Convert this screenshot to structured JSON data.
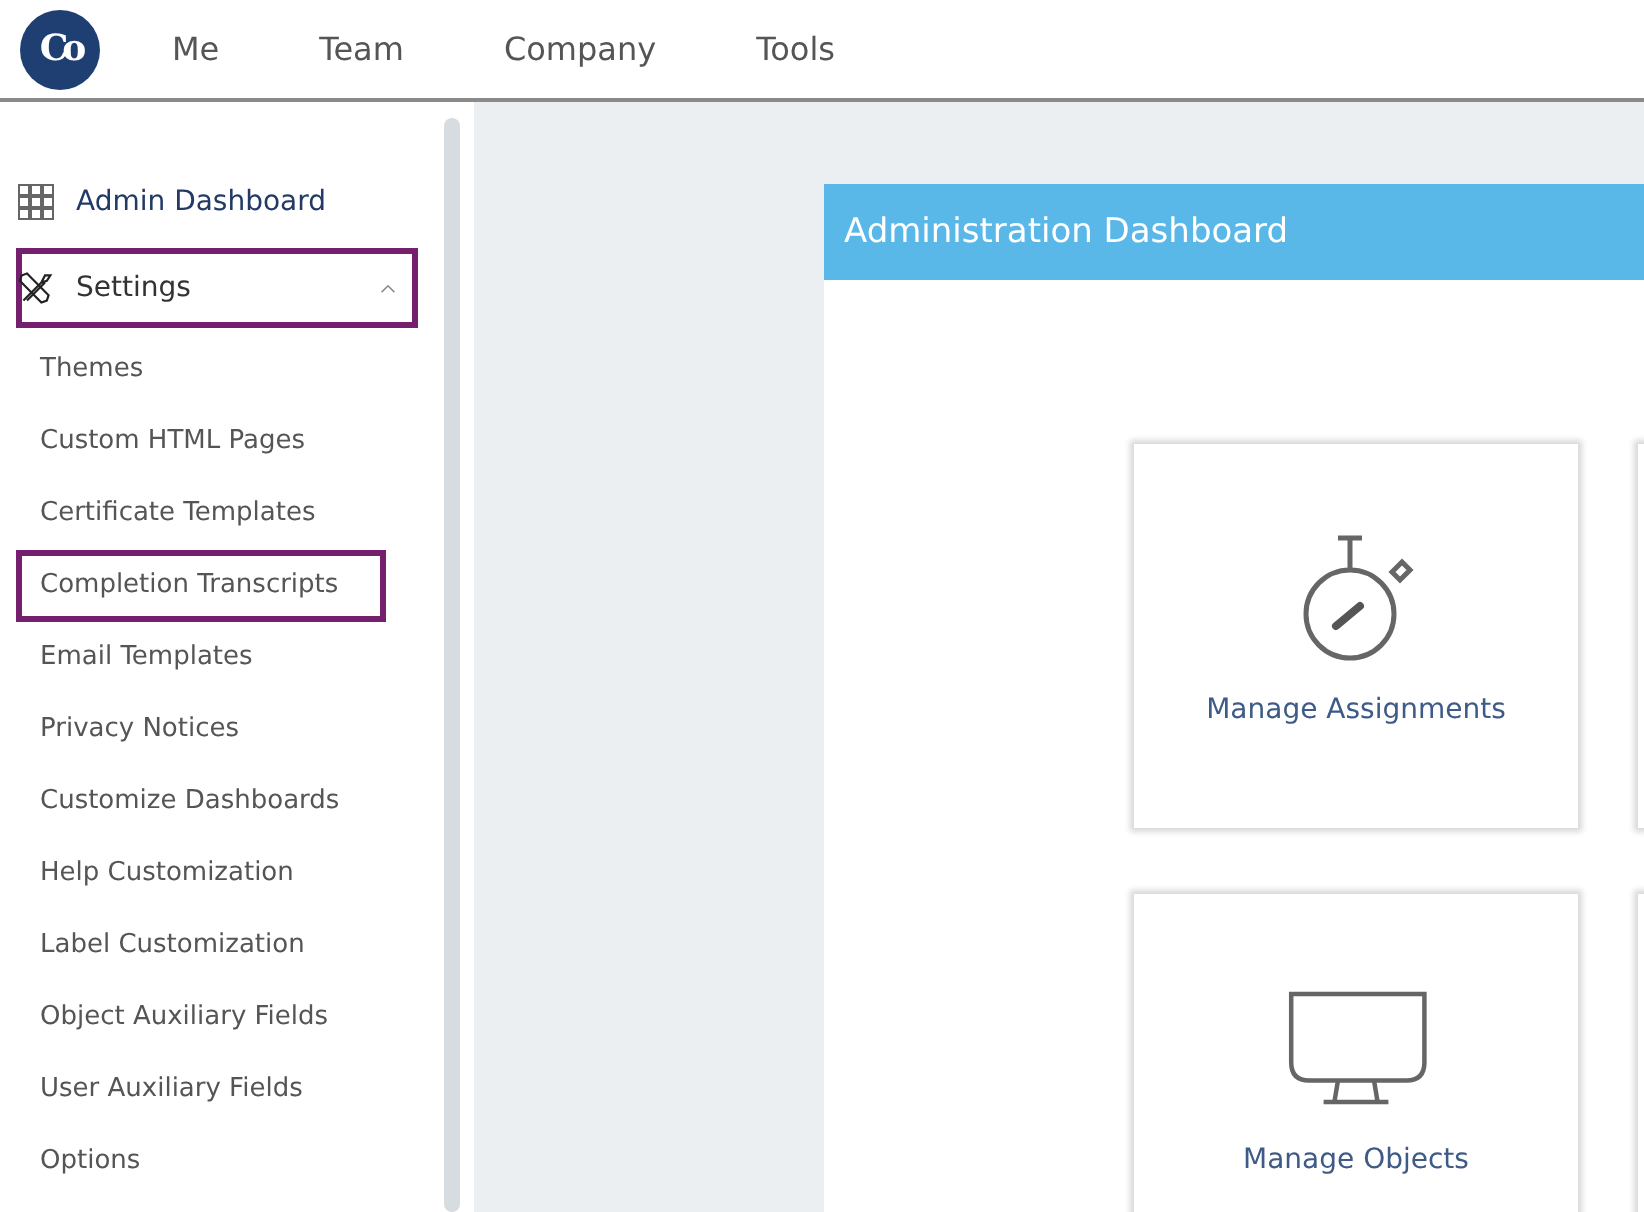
{
  "logo": {
    "text": "Co"
  },
  "nav": [
    {
      "label": "Me"
    },
    {
      "label": "Team"
    },
    {
      "label": "Company"
    },
    {
      "label": "Tools"
    }
  ],
  "sidebar": {
    "items": [
      {
        "label": "Admin Dashboard",
        "kind": "grid",
        "highlighted": false
      },
      {
        "label": "Settings",
        "kind": "tools",
        "highlighted": true,
        "expanded": true,
        "children": [
          {
            "label": "Themes",
            "highlighted": false
          },
          {
            "label": "Custom HTML Pages",
            "highlighted": false
          },
          {
            "label": "Certificate Templates",
            "highlighted": false
          },
          {
            "label": "Completion Transcripts",
            "highlighted": true
          },
          {
            "label": "Email Templates",
            "highlighted": false
          },
          {
            "label": "Privacy Notices",
            "highlighted": false
          },
          {
            "label": "Customize Dashboards",
            "highlighted": false
          },
          {
            "label": "Help Customization",
            "highlighted": false
          },
          {
            "label": "Label Customization",
            "highlighted": false
          },
          {
            "label": "Object Auxiliary Fields",
            "highlighted": false
          },
          {
            "label": "User Auxiliary Fields",
            "highlighted": false
          },
          {
            "label": "Options",
            "highlighted": false
          }
        ]
      }
    ]
  },
  "panel": {
    "title": "Administration Dashboard",
    "cards": [
      {
        "label": "Manage Assignments",
        "kind": "stopwatch"
      },
      {
        "label": "Manage Objects",
        "kind": "monitor"
      }
    ]
  }
}
